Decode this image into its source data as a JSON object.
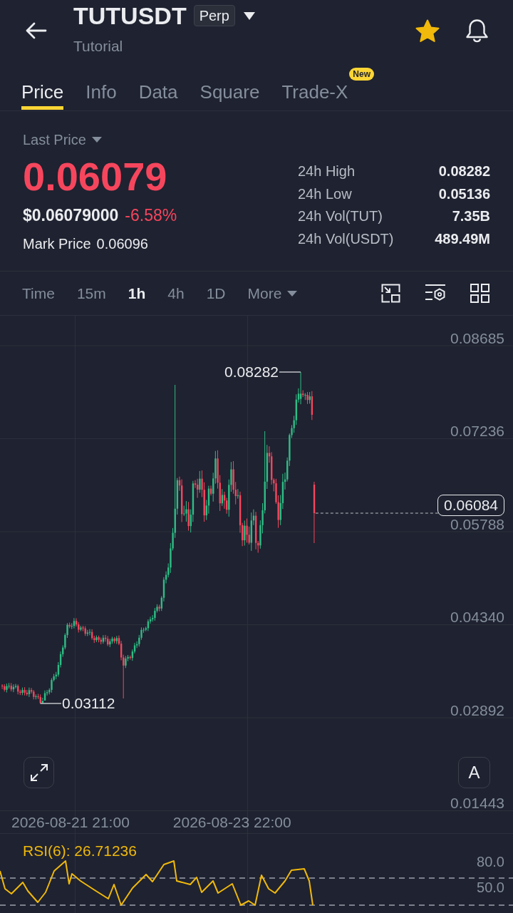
{
  "header": {
    "symbol": "TUTUSDT",
    "contract_badge": "Perp",
    "subtitle": "Tutorial",
    "favorite": true
  },
  "tabs": [
    {
      "label": "Price",
      "selected": true
    },
    {
      "label": "Info",
      "selected": false
    },
    {
      "label": "Data",
      "selected": false
    },
    {
      "label": "Square",
      "selected": false
    },
    {
      "label": "Trade-X",
      "selected": false,
      "badge": "New"
    }
  ],
  "price_panel": {
    "selector_label": "Last Price",
    "last_price": "0.06079",
    "falling": true,
    "usd_price": "$0.06079000",
    "change": "-6.58%",
    "mark_price_label": "Mark Price",
    "mark_price": "0.06096",
    "stats": [
      {
        "label": "24h High",
        "value": "0.08282"
      },
      {
        "label": "24h Low",
        "value": "0.05136"
      },
      {
        "label": "24h Vol(TUT)",
        "value": "7.35B"
      },
      {
        "label": "24h Vol(USDT)",
        "value": "489.49M"
      }
    ]
  },
  "chart_toolbar": {
    "intervals": [
      {
        "label": "Time",
        "selected": false
      },
      {
        "label": "15m",
        "selected": false
      },
      {
        "label": "1h",
        "selected": true
      },
      {
        "label": "4h",
        "selected": false
      },
      {
        "label": "1D",
        "selected": false
      }
    ],
    "more": "More"
  },
  "chart": {
    "price_axis": [
      "0.08685",
      "0.07236",
      "0.05788",
      "0.04340",
      "0.02892",
      "0.01443"
    ],
    "high_marker": "0.08282",
    "low_marker": "0.03112",
    "current_price_tag": "0.06084",
    "auto_scale_button": "A",
    "time_axis": [
      "2026-08-21 21:00",
      "2026-08-23 22:00"
    ]
  },
  "rsi": {
    "label": "RSI(6): 26.71236",
    "levels": [
      "80.0",
      "50.0"
    ]
  }
}
